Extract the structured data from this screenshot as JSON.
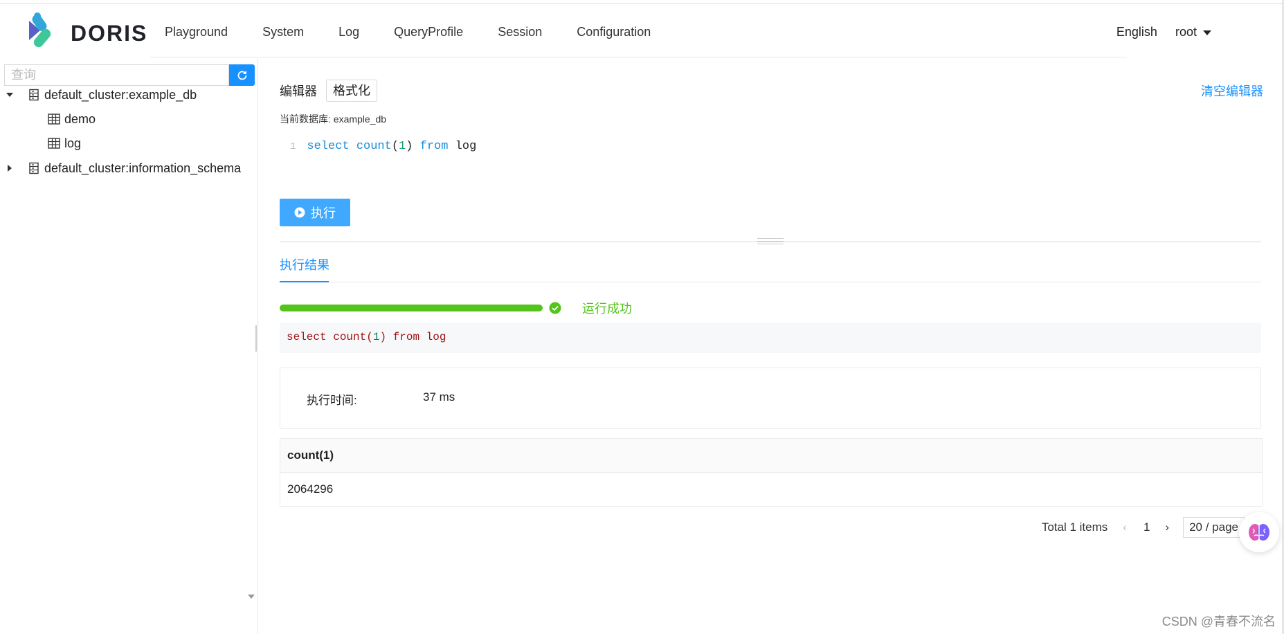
{
  "brand": {
    "name": "DORIS"
  },
  "nav": {
    "items": [
      "Playground",
      "System",
      "Log",
      "QueryProfile",
      "Session",
      "Configuration"
    ],
    "language": "English",
    "user": "root"
  },
  "sidebar": {
    "search_placeholder": "查询",
    "tree": [
      {
        "label": "default_cluster:example_db",
        "expanded": true
      },
      {
        "label": "demo"
      },
      {
        "label": "log"
      },
      {
        "label": "default_cluster:information_schema",
        "expanded": false
      }
    ]
  },
  "editor": {
    "label": "编辑器",
    "format_button": "格式化",
    "clear_label": "清空编辑器",
    "current_db_label": "当前数据库: example_db",
    "line_number": "1",
    "code_tokens": {
      "kw1": "select",
      "fn": "count",
      "open": "(",
      "arg": "1",
      "close": ")",
      "kw2": "from",
      "table": "log"
    }
  },
  "execute_button": "执行",
  "results": {
    "tab_label": "执行结果",
    "progress": 1.0,
    "status": "运行成功",
    "sql": {
      "p1": "select count(",
      "arg": "1",
      "p2": ") from log"
    },
    "time_label": "执行时间:",
    "time_value": "37 ms",
    "table": {
      "columns": [
        "count(1)"
      ],
      "rows": [
        [
          "2064296"
        ]
      ]
    },
    "pagination": {
      "total": "Total 1 items",
      "page": "1",
      "page_size": "20 / page"
    }
  },
  "watermark": "CSDN @青春不流名",
  "colors": {
    "accent": "#1890ff",
    "success": "#52c41a",
    "execute": "#40a9ff"
  }
}
